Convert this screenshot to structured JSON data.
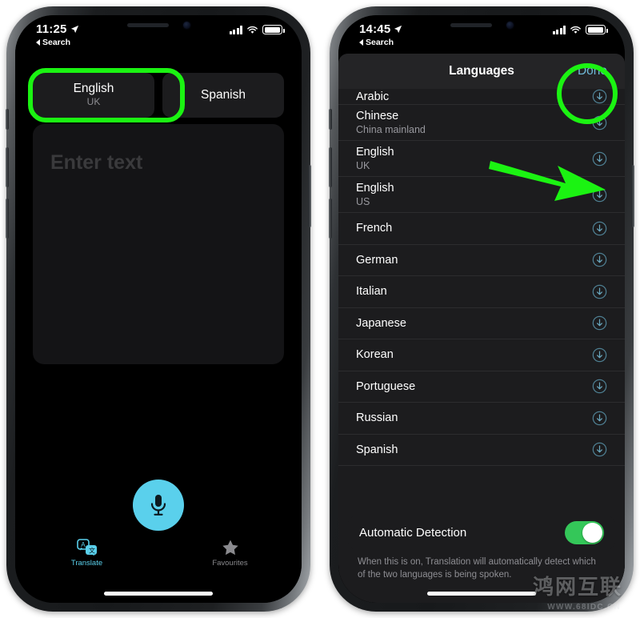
{
  "left_phone": {
    "status_bar": {
      "time": "11:25",
      "back_label": "Search",
      "location_icon": "location-arrow-icon",
      "signal_icon": "cellular-signal-icon",
      "wifi_icon": "wifi-icon",
      "battery_icon": "battery-icon"
    },
    "language_selector": {
      "source": {
        "title": "English",
        "subtitle": "UK"
      },
      "target": {
        "title": "Spanish",
        "subtitle": ""
      }
    },
    "text_card": {
      "placeholder": "Enter text"
    },
    "mic_button": {
      "icon": "microphone-icon"
    },
    "tab_bar": {
      "tabs": [
        {
          "label": "Translate",
          "icon": "translate-icon",
          "active": true
        },
        {
          "label": "Favourites",
          "icon": "star-icon",
          "active": false
        }
      ]
    },
    "highlight": {
      "color": "#1bf312",
      "target": "source-language-chip"
    }
  },
  "right_phone": {
    "status_bar": {
      "time": "14:45",
      "back_label": "Search",
      "location_icon": "location-arrow-icon",
      "signal_icon": "cellular-signal-icon",
      "wifi_icon": "wifi-icon",
      "battery_icon": "battery-icon"
    },
    "sheet": {
      "title": "Languages",
      "done_label": "Done",
      "done_color": "#6fb9d8",
      "languages": [
        {
          "name": "Arabic",
          "region": "",
          "download_icon": "download-circle-icon",
          "clipped": true
        },
        {
          "name": "Chinese",
          "region": "China mainland",
          "download_icon": "download-circle-icon"
        },
        {
          "name": "English",
          "region": "UK",
          "download_icon": "download-circle-icon"
        },
        {
          "name": "English",
          "region": "US",
          "download_icon": "download-circle-icon"
        },
        {
          "name": "French",
          "region": "",
          "download_icon": "download-circle-icon"
        },
        {
          "name": "German",
          "region": "",
          "download_icon": "download-circle-icon"
        },
        {
          "name": "Italian",
          "region": "",
          "download_icon": "download-circle-icon"
        },
        {
          "name": "Japanese",
          "region": "",
          "download_icon": "download-circle-icon"
        },
        {
          "name": "Korean",
          "region": "",
          "download_icon": "download-circle-icon"
        },
        {
          "name": "Portuguese",
          "region": "",
          "download_icon": "download-circle-icon"
        },
        {
          "name": "Russian",
          "region": "",
          "download_icon": "download-circle-icon"
        },
        {
          "name": "Spanish",
          "region": "",
          "download_icon": "download-circle-icon"
        }
      ]
    },
    "automatic_detection": {
      "label": "Automatic Detection",
      "toggle_state": "on",
      "toggle_color": "#34c759",
      "description": "When this is on, Translation will automatically detect which of the two languages is being spoken."
    },
    "highlight": {
      "color": "#1bf312",
      "target": "done-button"
    },
    "annotation_arrow": {
      "color": "#1bf312",
      "points_to": "automatic-detection-toggle"
    }
  },
  "watermark": {
    "text_cn": "鸿网互联",
    "url": "WWW.68IDC.CN"
  }
}
